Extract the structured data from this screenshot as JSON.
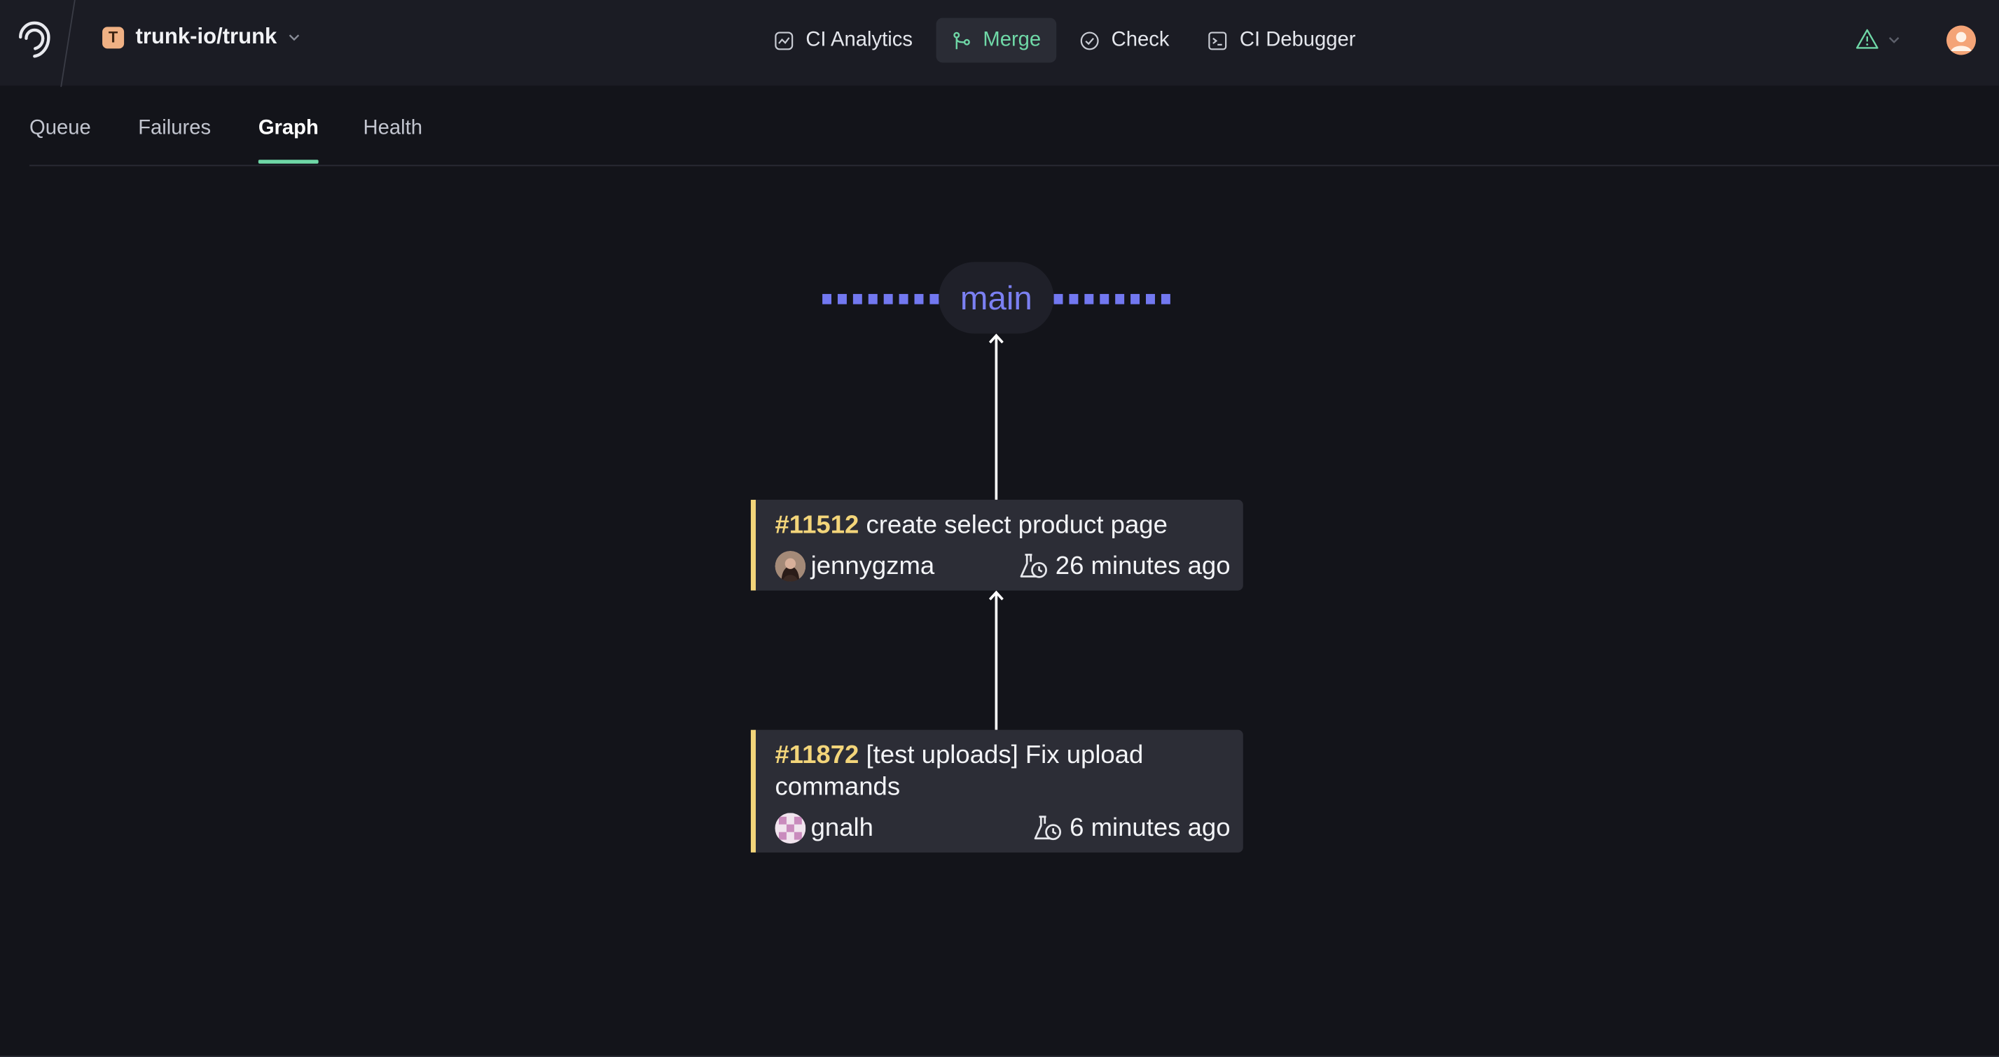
{
  "topbar": {
    "repo_initial": "T",
    "repo_name": "trunk-io/trunk",
    "nav": [
      {
        "label": "CI Analytics",
        "icon": "chart-icon",
        "active": false
      },
      {
        "label": "Merge",
        "icon": "merge-icon",
        "active": true
      },
      {
        "label": "Check",
        "icon": "check-circle-icon",
        "active": false
      },
      {
        "label": "CI Debugger",
        "icon": "terminal-icon",
        "active": false
      }
    ],
    "alert_icon": "warning-icon",
    "accent_color": "#6fd8a7"
  },
  "tabs": [
    {
      "label": "Queue",
      "active": false
    },
    {
      "label": "Failures",
      "active": false
    },
    {
      "label": "Graph",
      "active": true
    },
    {
      "label": "Health",
      "active": false
    }
  ],
  "graph": {
    "branch": "main",
    "branch_color": "#7b80f2",
    "pull_requests": [
      {
        "number": "#11512",
        "title": "create select product page",
        "author": "jennygzma",
        "time": "26 minutes ago"
      },
      {
        "number": "#11872",
        "title": "[test uploads] Fix upload commands",
        "author": "gnalh",
        "time": "6 minutes ago"
      }
    ],
    "card_accent_color": "#f3d57a"
  }
}
